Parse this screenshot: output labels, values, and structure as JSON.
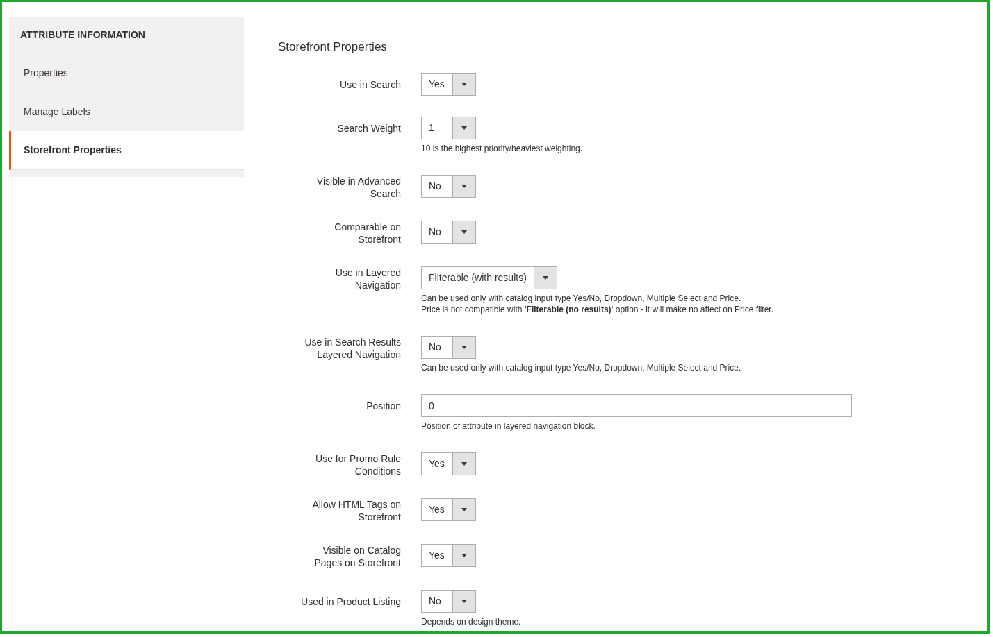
{
  "sidebar": {
    "title": "ATTRIBUTE INFORMATION",
    "items": [
      {
        "label": "Properties",
        "selected": false
      },
      {
        "label": "Manage Labels",
        "selected": false
      },
      {
        "label": "Storefront Properties",
        "selected": true
      }
    ]
  },
  "section": {
    "title": "Storefront Properties"
  },
  "fields": [
    {
      "kind": "select",
      "label": "Use in Search",
      "value": "Yes"
    },
    {
      "kind": "select",
      "label": "Search Weight",
      "value": "1",
      "notes": [
        "10 is the highest priority/heaviest weighting."
      ]
    },
    {
      "kind": "select",
      "label": "Visible in Advanced Search",
      "value": "No"
    },
    {
      "kind": "select",
      "label": "Comparable on Storefront",
      "value": "No"
    },
    {
      "kind": "select",
      "label": "Use in Layered Navigation",
      "value": "Filterable (with results)",
      "notes": [
        "Can be used only with catalog input type Yes/No, Dropdown, Multiple Select and Price.",
        "Price is not compatible with **'Filterable (no results)'** option - it will make no affect on Price filter."
      ]
    },
    {
      "kind": "select",
      "label": "Use in Search Results Layered Navigation",
      "value": "No",
      "notes": [
        "Can be used only with catalog input type Yes/No, Dropdown, Multiple Select and Price."
      ]
    },
    {
      "kind": "text",
      "label": "Position",
      "value": "0",
      "notes": [
        "Position of attribute in layered navigation block."
      ]
    },
    {
      "kind": "select",
      "label": "Use for Promo Rule Conditions",
      "value": "Yes"
    },
    {
      "kind": "select",
      "label": "Allow HTML Tags on Storefront",
      "value": "Yes"
    },
    {
      "kind": "select",
      "label": "Visible on Catalog Pages on Storefront",
      "value": "Yes"
    },
    {
      "kind": "select",
      "label": "Used in Product Listing",
      "value": "No",
      "notes": [
        "Depends on design theme."
      ]
    }
  ]
}
